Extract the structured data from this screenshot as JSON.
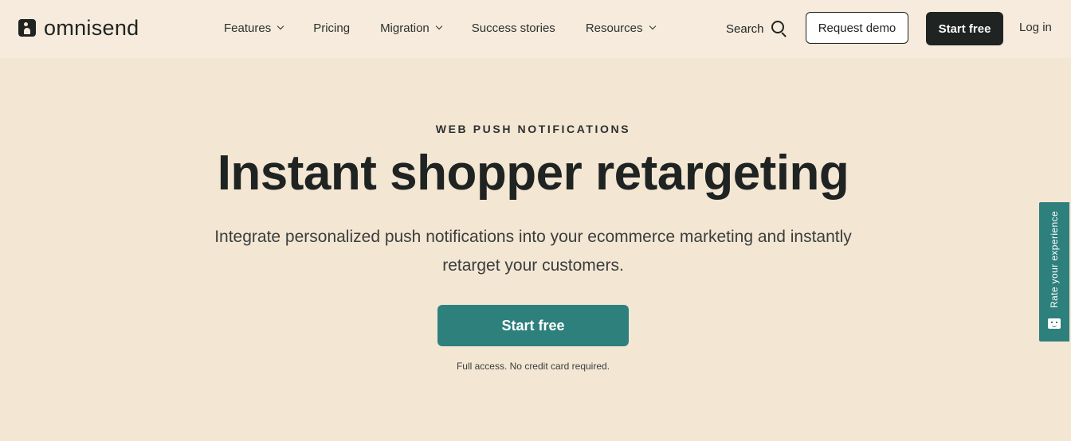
{
  "header": {
    "logo_text": "omnisend",
    "nav": [
      {
        "label": "Features",
        "has_dropdown": true
      },
      {
        "label": "Pricing",
        "has_dropdown": false
      },
      {
        "label": "Migration",
        "has_dropdown": true
      },
      {
        "label": "Success stories",
        "has_dropdown": false
      },
      {
        "label": "Resources",
        "has_dropdown": true
      }
    ],
    "search_label": "Search",
    "request_demo_label": "Request demo",
    "start_free_label": "Start free",
    "login_label": "Log in"
  },
  "hero": {
    "eyebrow": "WEB PUSH NOTIFICATIONS",
    "title": "Instant shopper retargeting",
    "subtitle": "Integrate personalized push notifications into your ecommerce marketing and instantly retarget your customers.",
    "cta_label": "Start free",
    "note": "Full access. No credit card required."
  },
  "feedback_tab": {
    "label": "Rate your experience"
  },
  "colors": {
    "page_bg": "#f3e6d3",
    "header_bg": "#f6ebdc",
    "accent_teal": "#2e807d",
    "dark": "#1f2322"
  }
}
